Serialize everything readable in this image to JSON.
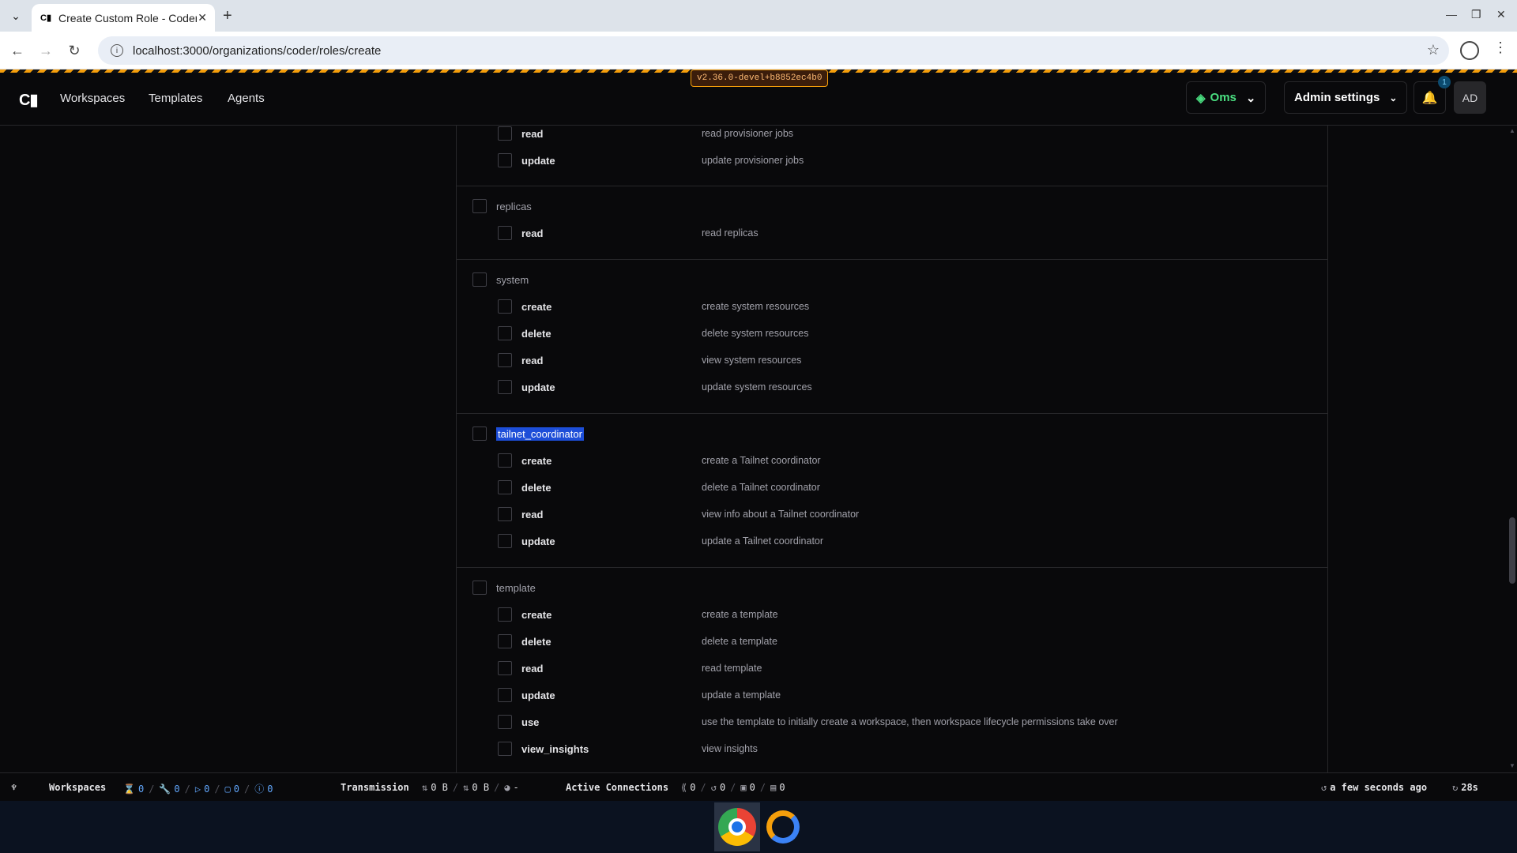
{
  "browser": {
    "tab_title": "Create Custom Role - Coder",
    "url": "localhost:3000/organizations/coder/roles/create"
  },
  "navbar": {
    "logo": "C▮",
    "links": [
      "Workspaces",
      "Templates",
      "Agents"
    ],
    "version": "v2.36.0-devel+b8852ec4b0",
    "org_label": "Oms",
    "admin_label": "Admin settings",
    "notification_count": "1",
    "avatar": "AD"
  },
  "groups": [
    {
      "name": "",
      "perms": [
        {
          "name": "read",
          "desc": "read provisioner jobs"
        },
        {
          "name": "update",
          "desc": "update provisioner jobs"
        }
      ]
    },
    {
      "name": "replicas",
      "perms": [
        {
          "name": "read",
          "desc": "read replicas"
        }
      ]
    },
    {
      "name": "system",
      "perms": [
        {
          "name": "create",
          "desc": "create system resources"
        },
        {
          "name": "delete",
          "desc": "delete system resources"
        },
        {
          "name": "read",
          "desc": "view system resources"
        },
        {
          "name": "update",
          "desc": "update system resources"
        }
      ]
    },
    {
      "name": "tailnet_coordinator",
      "selected": true,
      "perms": [
        {
          "name": "create",
          "desc": "create a Tailnet coordinator"
        },
        {
          "name": "delete",
          "desc": "delete a Tailnet coordinator"
        },
        {
          "name": "read",
          "desc": "view info about a Tailnet coordinator"
        },
        {
          "name": "update",
          "desc": "update a Tailnet coordinator"
        }
      ]
    },
    {
      "name": "template",
      "perms": [
        {
          "name": "create",
          "desc": "create a template"
        },
        {
          "name": "delete",
          "desc": "delete a template"
        },
        {
          "name": "read",
          "desc": "read template"
        },
        {
          "name": "update",
          "desc": "update a template"
        },
        {
          "name": "use",
          "desc": "use the template to initially create a workspace, then workspace lifecycle permissions take over"
        },
        {
          "name": "view_insights",
          "desc": "view insights"
        }
      ]
    }
  ],
  "statusbar": {
    "workspaces_label": "Workspaces",
    "ws_counts": [
      "0",
      "0",
      "0",
      "0",
      "0"
    ],
    "transmission_label": "Transmission",
    "tx": [
      "0 B",
      "0 B",
      "-"
    ],
    "connections_label": "Active Connections",
    "conn_counts": [
      "0",
      "0",
      "0",
      "0"
    ],
    "updated": "a few seconds ago",
    "refresh": "28s"
  }
}
